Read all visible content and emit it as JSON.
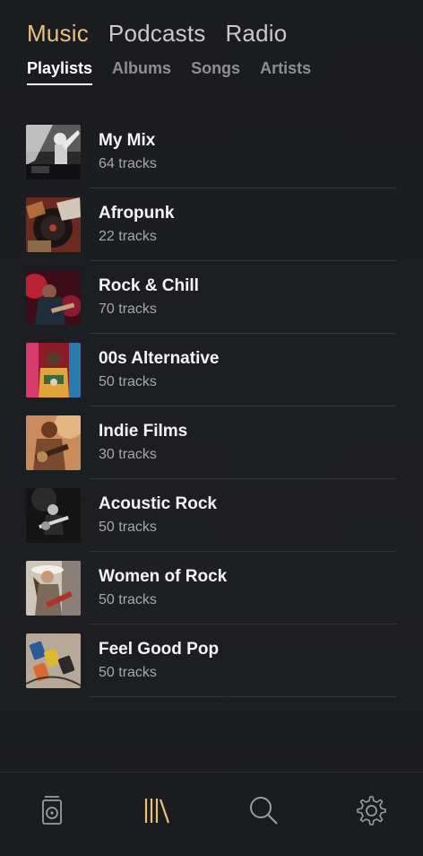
{
  "top_tabs": [
    {
      "label": "Music",
      "active": true
    },
    {
      "label": "Podcasts",
      "active": false
    },
    {
      "label": "Radio",
      "active": false
    }
  ],
  "sub_tabs": [
    {
      "label": "Playlists",
      "active": true
    },
    {
      "label": "Albums",
      "active": false
    },
    {
      "label": "Songs",
      "active": false
    },
    {
      "label": "Artists",
      "active": false
    }
  ],
  "playlists": [
    {
      "title": "My Mix",
      "tracks": "64 tracks",
      "art": "dj-bw"
    },
    {
      "title": "Afropunk",
      "tracks": "22 tracks",
      "art": "vinyl-red"
    },
    {
      "title": "Rock & Chill",
      "tracks": "70 tracks",
      "art": "stage-red"
    },
    {
      "title": "00s Alternative",
      "tracks": "50 tracks",
      "art": "colorful-artist"
    },
    {
      "title": "Indie Films",
      "tracks": "30 tracks",
      "art": "warm-guitar"
    },
    {
      "title": "Acoustic Rock",
      "tracks": "50 tracks",
      "art": "bw-guitar"
    },
    {
      "title": "Women of Rock",
      "tracks": "50 tracks",
      "art": "hat-guitar"
    },
    {
      "title": "Feel Good Pop",
      "tracks": "50 tracks",
      "art": "pedals"
    }
  ],
  "bottom_nav": [
    {
      "icon": "speaker-icon",
      "active": false
    },
    {
      "icon": "library-icon",
      "active": true
    },
    {
      "icon": "search-icon",
      "active": false
    },
    {
      "icon": "settings-gear-icon",
      "active": false
    }
  ],
  "colors": {
    "accent": "#e8c27a",
    "background": "#1b1c20",
    "text_primary": "#f4f4f5",
    "text_secondary": "#a6a7ab",
    "divider": "#34353a"
  }
}
